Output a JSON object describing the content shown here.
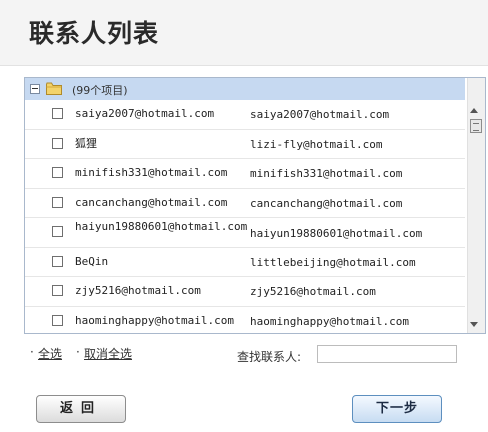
{
  "header": {
    "title": "联系人列表"
  },
  "list": {
    "group_label": "(99个项目)",
    "contacts": [
      {
        "name": "saiya2007@hotmail.com",
        "email": "saiya2007@hotmail.com"
      },
      {
        "name": "狐狸",
        "email": "lizi-fly@hotmail.com"
      },
      {
        "name": "minifish331@hotmail.com",
        "email": "minifish331@hotmail.com"
      },
      {
        "name": "cancanchang@hotmail.com",
        "email": "cancanchang@hotmail.com"
      },
      {
        "name": "haiyun19880601@hotmail.com",
        "email": "haiyun19880601@hotmail.com"
      },
      {
        "name": "BeQin",
        "email": "littlebeijing@hotmail.com"
      },
      {
        "name": "zjy5216@hotmail.com",
        "email": "zjy5216@hotmail.com"
      },
      {
        "name": "haominghappy@hotmail.com",
        "email": "haominghappy@hotmail.com"
      }
    ]
  },
  "controls": {
    "select_all": "全选",
    "deselect_all": "取消全选",
    "find_label": "查找联系人:",
    "find_value": ""
  },
  "buttons": {
    "back": "返回",
    "next": "下一步"
  },
  "icons": {
    "folder": "folder-icon",
    "collapse": "minus-icon"
  }
}
